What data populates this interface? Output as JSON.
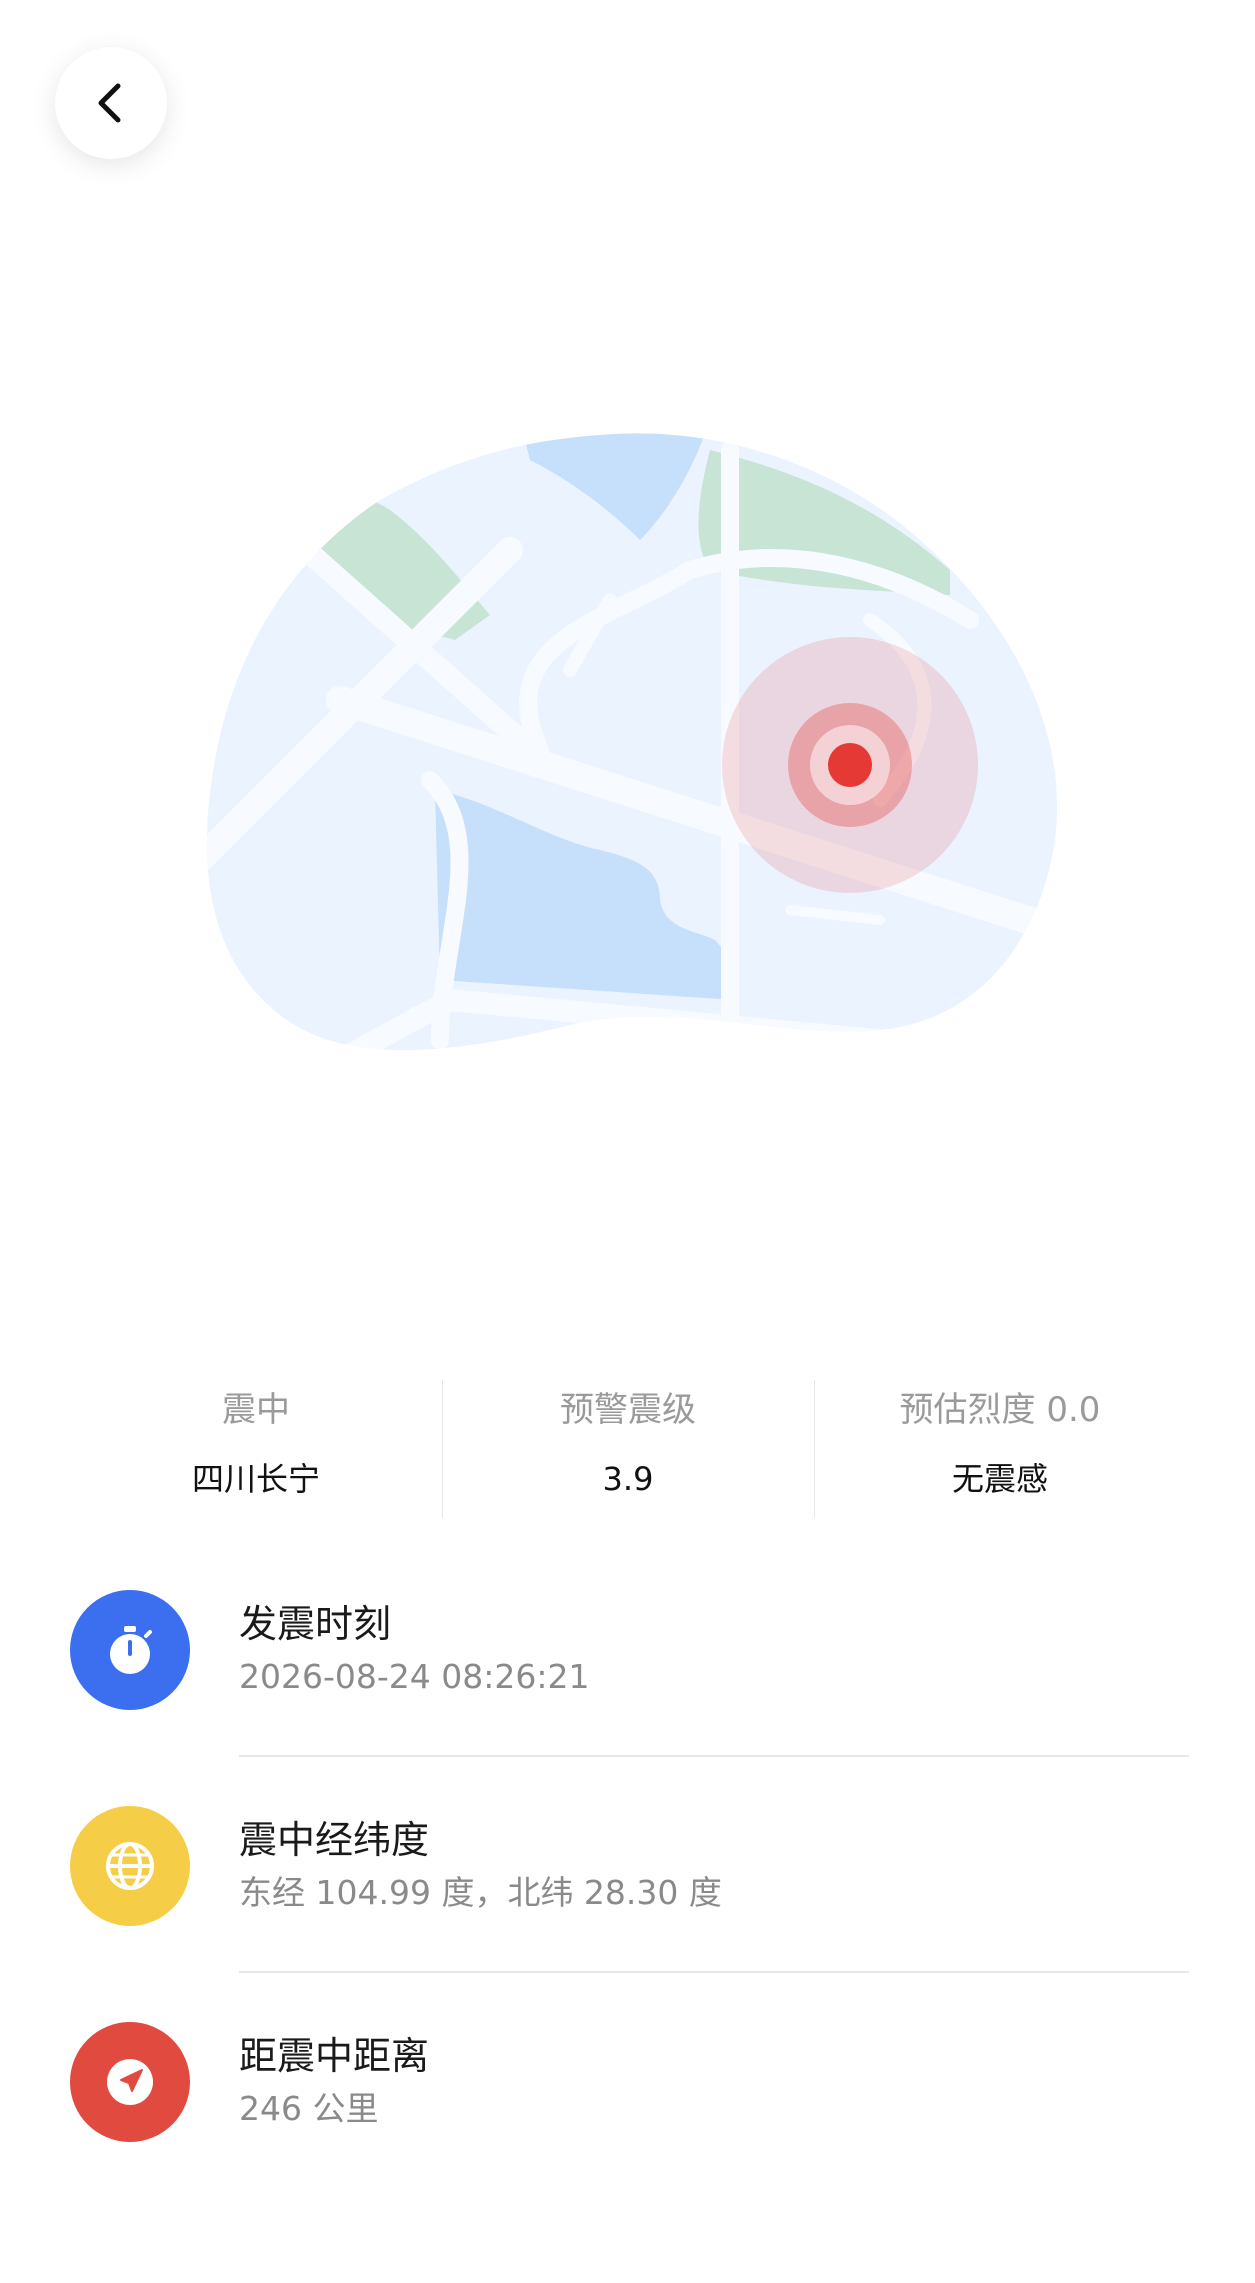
{
  "nav": {
    "back_icon": "chevron-left-icon"
  },
  "map": {
    "marker_color": "#e53935",
    "land_color": "#eaf3fe",
    "water_color": "#c6dffb",
    "park_color": "#c8e4d4"
  },
  "stats": [
    {
      "label": "震中",
      "value": "四川长宁"
    },
    {
      "label": "预警震级",
      "value": "3.9"
    },
    {
      "label": "预估烈度 0.0",
      "value": "无震感"
    }
  ],
  "details": [
    {
      "icon": "stopwatch-icon",
      "color": "#3b6ff0",
      "title": "发震时刻",
      "value": "2026-08-24 08:26:21"
    },
    {
      "icon": "globe-icon",
      "color": "#f5cd47",
      "title": "震中经纬度",
      "value": "东经 104.99 度，北纬 28.30 度"
    },
    {
      "icon": "navigation-arrow-icon",
      "color": "#e04a3f",
      "title": "距震中距离",
      "value": "246 公里"
    }
  ]
}
